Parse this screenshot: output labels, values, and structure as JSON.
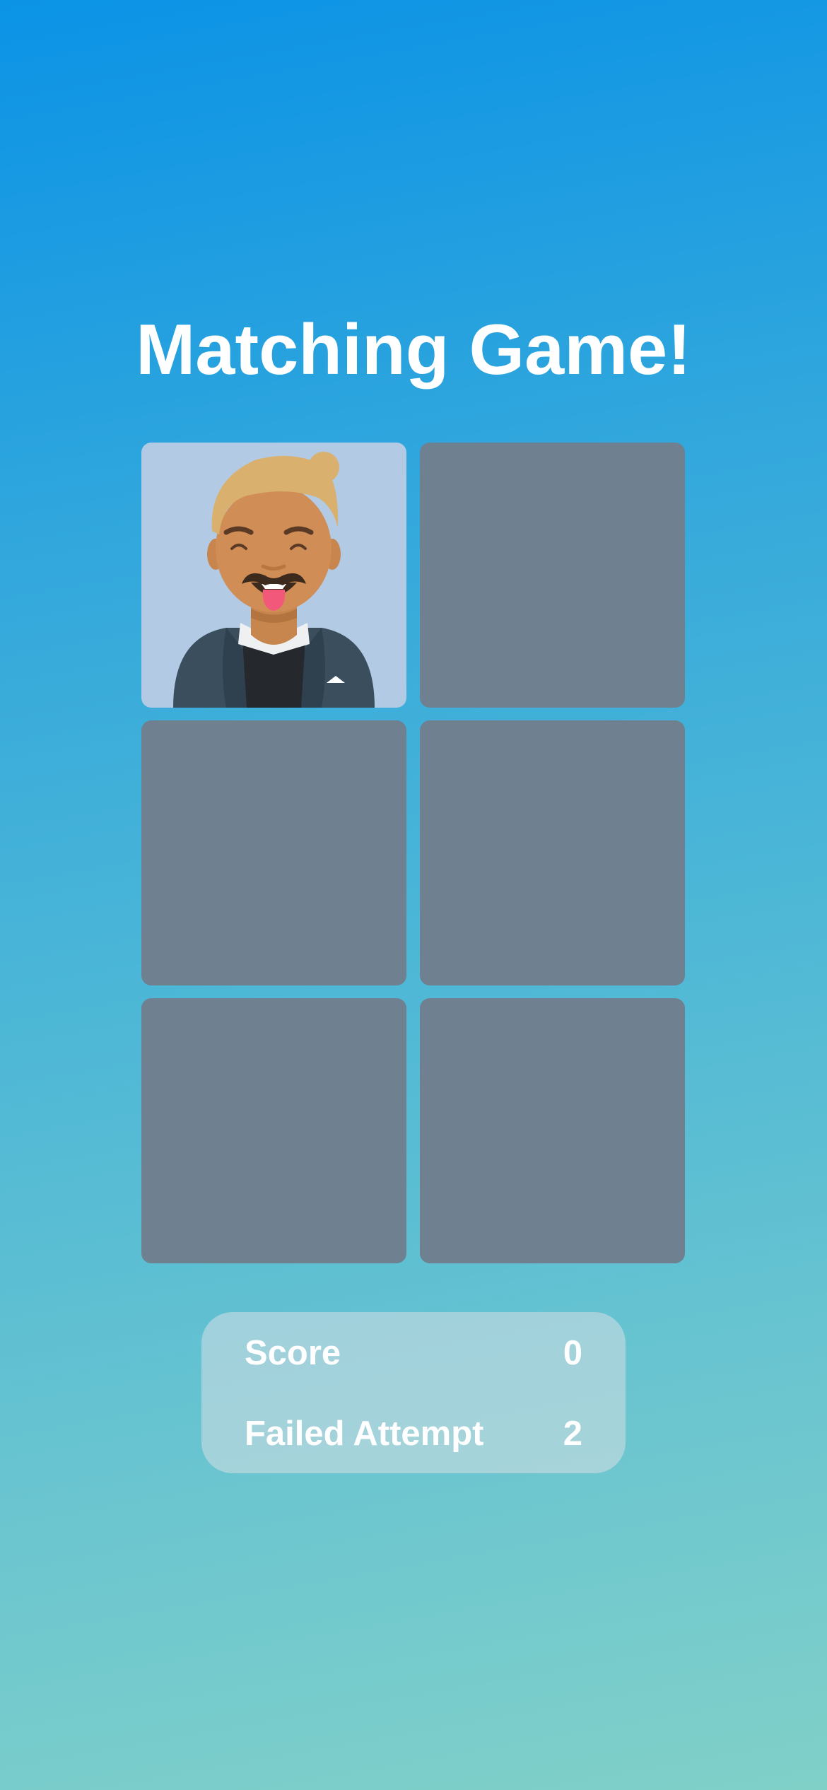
{
  "title": "Matching Game!",
  "cards": [
    {
      "state": "face-up",
      "image": "avatar-man-mustache-tongue"
    },
    {
      "state": "face-down"
    },
    {
      "state": "face-down"
    },
    {
      "state": "face-down"
    },
    {
      "state": "face-down"
    },
    {
      "state": "face-down"
    }
  ],
  "scoreboard": {
    "score_label": "Score",
    "score_value": "0",
    "failed_label": "Failed Attempt",
    "failed_value": "2"
  },
  "colors": {
    "card_back": "#6f8090",
    "card_face": "#b2cae3",
    "background_top": "#0b93e6",
    "background_bottom": "#80d0c8"
  }
}
